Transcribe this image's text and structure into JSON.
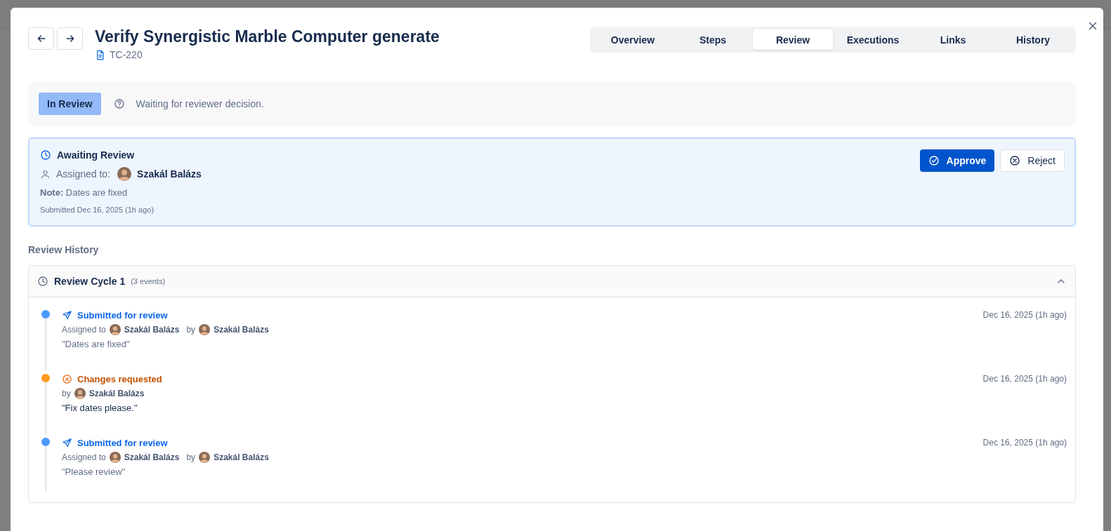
{
  "header": {
    "title": "Verify Synergistic Marble Computer generate",
    "key": "TC-220"
  },
  "tabs": [
    {
      "label": "Overview",
      "selected": false
    },
    {
      "label": "Steps",
      "selected": false
    },
    {
      "label": "Review",
      "selected": true
    },
    {
      "label": "Executions",
      "selected": false
    },
    {
      "label": "Links",
      "selected": false
    },
    {
      "label": "History",
      "selected": false
    }
  ],
  "status": {
    "badge": "In Review",
    "message": "Waiting for reviewer decision."
  },
  "awaiting": {
    "title": "Awaiting Review",
    "assigned_label": "Assigned to:",
    "assignee": "Szakál Balázs",
    "note_label": "Note:",
    "note": "Dates are fixed",
    "submitted": "Submitted Dec 16, 2025 (1h ago)",
    "approve": "Approve",
    "reject": "Reject"
  },
  "history": {
    "title": "Review History",
    "cycle": "Review Cycle 1",
    "count": "(3 events)",
    "expanded": true,
    "events": [
      {
        "kind": "submitted",
        "color": "#4c9aff",
        "title": "Submitted for review",
        "assigned_label": "Assigned to",
        "assignee": "Szakál Balázs",
        "by_label": "by",
        "by": "Szakál Balázs",
        "note": "\"Dates are fixed\"",
        "time": "Dec 16, 2025 (1h ago)"
      },
      {
        "kind": "changes",
        "color": "#ff991f",
        "title": "Changes requested",
        "by_label": "by",
        "by": "Szakál Balázs",
        "note": "\"Fix dates please.\"",
        "time": "Dec 16, 2025 (1h ago)"
      },
      {
        "kind": "submitted",
        "color": "#4c9aff",
        "title": "Submitted for review",
        "assigned_label": "Assigned to",
        "assignee": "Szakál Balázs",
        "by_label": "by",
        "by": "Szakál Balázs",
        "note": "\"Please review\"",
        "time": "Dec 16, 2025 (1h ago)"
      }
    ]
  }
}
